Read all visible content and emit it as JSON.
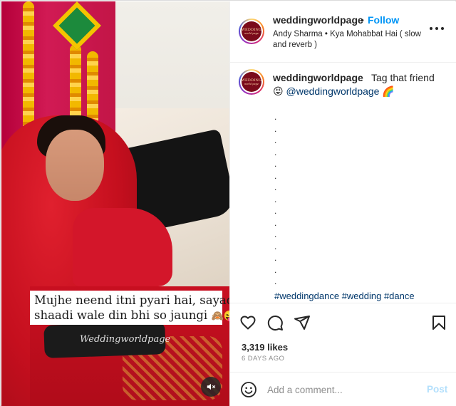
{
  "post": {
    "media": {
      "caption_line1": "Mujhe neend itni pyari hai, sayad",
      "caption_line2": "shaadi wale din bhi so jaungi",
      "caption_emojis": "🙈😝",
      "watermark": "Weddingworldpage",
      "mute_icon": "speaker-muted-icon"
    },
    "header": {
      "username": "weddingworldpage",
      "separator": "•",
      "follow_label": "Follow",
      "audio_line": "Andy Sharma • Kya Mohabbat Hai ( slow and reverb )",
      "more_icon": "more-horizontal-icon",
      "avatar_text": "WEDDING",
      "avatar_subtext": "world page"
    },
    "caption": {
      "username": "weddingworldpage",
      "text": "Tag that friend",
      "emoji": "😝",
      "mention": "@weddingworldpage",
      "rainbow": "🌈",
      "dots": [
        ".",
        ".",
        ".",
        ".",
        ".",
        ".",
        ".",
        ".",
        ".",
        ".",
        ".",
        ".",
        ".",
        ".",
        "."
      ],
      "hashtags": "#weddingdance #wedding #dance"
    },
    "actions": {
      "like_icon": "heart-icon",
      "comment_icon": "comment-icon",
      "share_icon": "send-icon",
      "save_icon": "bookmark-icon",
      "likes": "3,319 likes",
      "time_ago": "6 DAYS AGO"
    },
    "comment_box": {
      "emoji_icon": "smiley-icon",
      "placeholder": "Add a comment...",
      "post_label": "Post"
    }
  },
  "colors": {
    "accent": "#0095f6",
    "link": "#00376b",
    "muted": "#8e8e8e",
    "post_disabled": "#b2dffc"
  }
}
